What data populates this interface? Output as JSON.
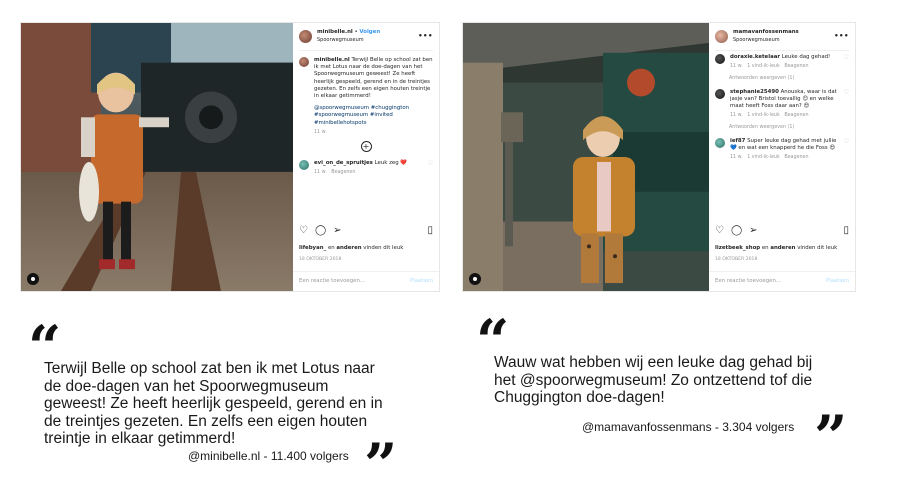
{
  "post1": {
    "username": "minibelle.nl",
    "follow_label": "Volgen",
    "location": "Spoorwegmuseum",
    "more_icon": "ellipsis-icon",
    "caption": "Terwijl Belle op school zat ben ik met Lotus naar de doe-dagen van het Spoorwegmuseum geweest! Ze heeft heerlijk gespeeld, gerend en in de treintjes gezeten. En zelfs een eigen houten treintje in elkaar getimmerd!",
    "hashtags": "@spoorwegmuseum #chuggington #spoorwegmuseum #invited #minibellehotspots",
    "caption_time": "11 w.",
    "comment_user": "evi_on_de_spruitjes",
    "comment_text": "Leuk zeg ❤️",
    "comment_time": "11 w.",
    "comment_reply": "Beagenen",
    "likes_user": "lifebyan_",
    "likes_joiner": "en",
    "likes_others": "anderen",
    "likes_suffix": "vinden dit leuk",
    "date": "18 OKTOBER 2018",
    "add_comment_placeholder": "Een reactie toevoegen...",
    "post_button": "Plaatsen"
  },
  "post2": {
    "username": "mamavanfossenmans",
    "follow_label": "Volgen",
    "location": "Spoorwegmuseum",
    "more_icon": "ellipsis-icon",
    "comments": [
      {
        "user": "doraxie.ketelaar",
        "text": "Leuke dag gehad!",
        "time": "11 w.",
        "likes": "1 vind-ik-leuk",
        "reply": "Beagenen",
        "replies": "Antwoorden weergeven (1)"
      },
      {
        "user": "stephanie25490",
        "text": "Anouska, waar is dat jasje van? Bristol toevallig 😊 en welke maat heeft Foss daar aan? 😍",
        "time": "11 w.",
        "likes": "1 vind-ik-leuk",
        "reply": "Beagenen",
        "replies": "Antwoorden weergeven (1)"
      },
      {
        "user": "ief87",
        "text": "Super leuke dag gehad met jullie 💙 en wat een knapperd he die Foss 😍",
        "time": "11 w.",
        "likes": "1 vind-ik-leuk",
        "reply": "Beagenen",
        "replies": ""
      }
    ],
    "likes_user": "lizetbeek_shop",
    "likes_joiner": "en",
    "likes_others": "anderen",
    "likes_suffix": "vinden dit leuk",
    "date": "18 OKTOBER 2018",
    "add_comment_placeholder": "Een reactie toevoegen...",
    "post_button": "Plaatsen"
  },
  "quote1": {
    "text": "Terwijl Belle op school zat ben ik met Lotus naar de doe-dagen van het Spoorwegmuseum geweest! Ze heeft heerlijk gespeeld, gerend en in de treintjes gezeten. En zelfs een eigen houten treintje in elkaar getimmerd!",
    "author": "@minibelle.nl - 11.400 volgers",
    "open_mark": "“",
    "close_mark": "”"
  },
  "quote2": {
    "text": "Wauw wat hebben wij een leuke dag gehad bij het @spoorwegmuseum! Zo ontzettend tof die Chuggington doe-dagen!",
    "author": "@mamavanfossenmans - 3.304 volgers",
    "open_mark": "“",
    "close_mark": "”"
  },
  "icons": {
    "like": "heart-icon",
    "comment": "comment-icon",
    "share": "share-icon",
    "save": "bookmark-icon",
    "add": "plus-circle-icon",
    "user_tag": "user-tag-icon"
  }
}
